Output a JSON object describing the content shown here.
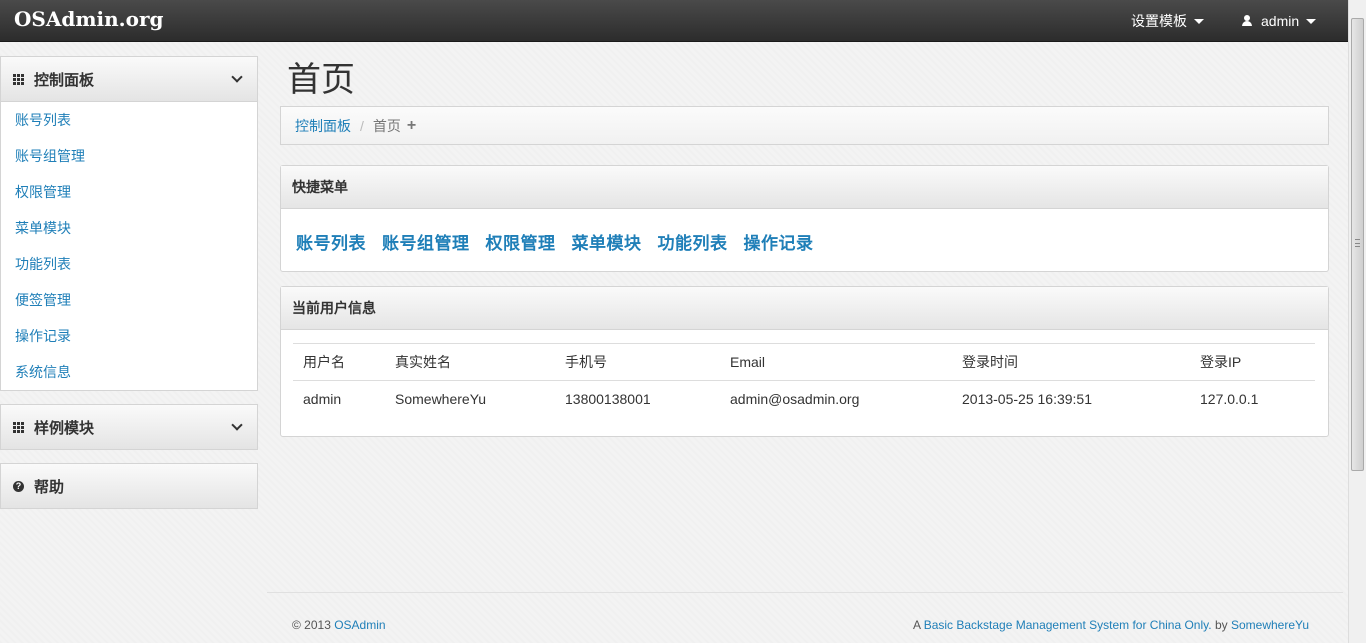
{
  "navbar": {
    "brand": "OSAdmin.org",
    "template_menu": "设置模板",
    "user_menu": "admin"
  },
  "sidebar": {
    "control_panel": {
      "title": "控制面板",
      "items": [
        "账号列表",
        "账号组管理",
        "权限管理",
        "菜单模块",
        "功能列表",
        "便签管理",
        "操作记录",
        "系统信息"
      ]
    },
    "sample_module": {
      "title": "样例模块"
    },
    "help": {
      "title": "帮助"
    }
  },
  "main": {
    "page_title": "首页",
    "breadcrumb": {
      "parent": "控制面板",
      "separator": "/",
      "current": "首页",
      "add": "+"
    },
    "quick_menu": {
      "title": "快捷菜单",
      "links": [
        "账号列表",
        "账号组管理",
        "权限管理",
        "菜单模块",
        "功能列表",
        "操作记录"
      ]
    },
    "user_info": {
      "title": "当前用户信息",
      "columns": [
        "用户名",
        "真实姓名",
        "手机号",
        "Email",
        "登录时间",
        "登录IP"
      ],
      "row": [
        "admin",
        "SomewhereYu",
        "13800138001",
        "admin@osadmin.org",
        "2013-05-25 16:39:51",
        "127.0.0.1"
      ]
    }
  },
  "footer": {
    "copyright": "© 2013",
    "site_link": "OSAdmin",
    "tagline_prefix": "A",
    "tagline_link": "Basic Backstage Management System for China Only.",
    "by": "by",
    "author_link": "SomewhereYu"
  }
}
